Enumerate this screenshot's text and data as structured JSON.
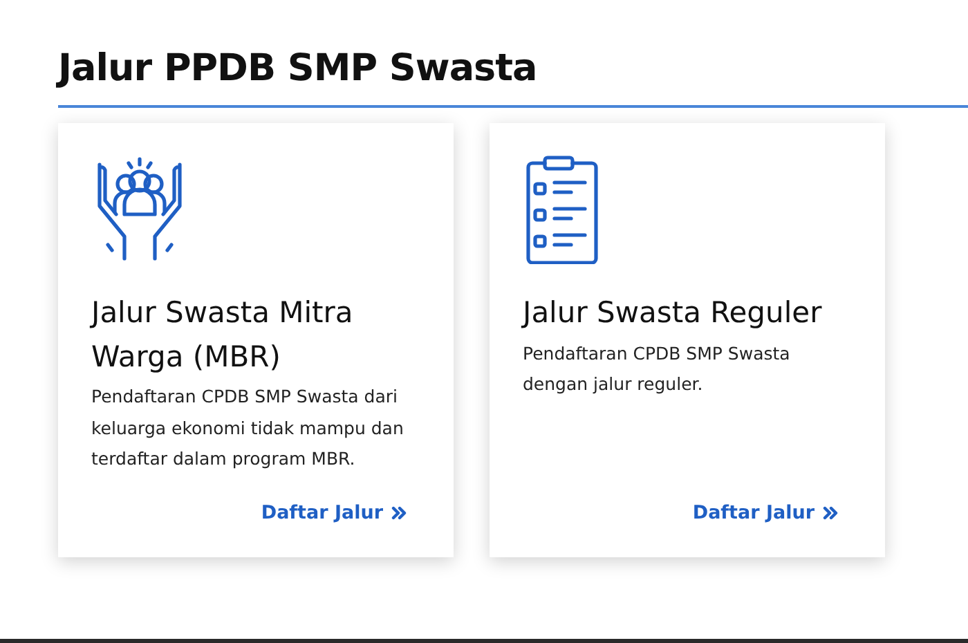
{
  "heading": "Jalur PPDB SMP Swasta",
  "cards": [
    {
      "title": "Jalur Swasta Mitra Warga (MBR)",
      "description": "Pendaftaran CPDB SMP Swasta dari keluarga ekonomi tidak mampu dan terdaftar dalam program MBR.",
      "link": "Daftar Jalur"
    },
    {
      "title": "Jalur Swasta Reguler",
      "description": "Pendaftaran CPDB SMP Swasta dengan jalur reguler.",
      "link": "Daftar Jalur"
    }
  ]
}
